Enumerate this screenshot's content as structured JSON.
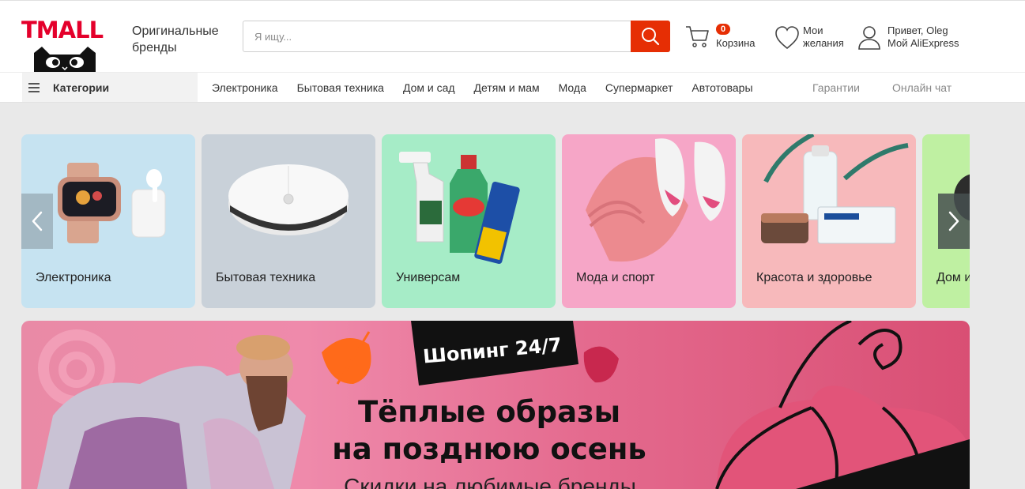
{
  "header": {
    "logo_text": "TMALL",
    "brand_tagline": "Оригинальные бренды",
    "search_placeholder": "Я ищу...",
    "cart_count": "0",
    "cart_label": "Корзина",
    "wishlist_label_1": "Мои",
    "wishlist_label_2": "желания",
    "account_greeting": "Привет, Oleg",
    "account_link": "Мой AliExpress"
  },
  "nav": {
    "categories_label": "Категории",
    "links": [
      "Электроника",
      "Бытовая техника",
      "Дом и сад",
      "Детям и мам",
      "Мода",
      "Супермаркет",
      "Автотовары"
    ],
    "right_links": [
      "Гарантии",
      "Онлайн чат"
    ]
  },
  "category_cards": [
    {
      "label": "Электроника",
      "bg": "#c6e3f1"
    },
    {
      "label": "Бытовая техника",
      "bg": "#c9d1d9"
    },
    {
      "label": "Универсам",
      "bg": "#a6ecc7"
    },
    {
      "label": "Мода и спорт",
      "bg": "#f6a6c7"
    },
    {
      "label": "Красота и здоровье",
      "bg": "#f7b9bb"
    },
    {
      "label": "Дом и",
      "bg": "#bff0a2"
    }
  ],
  "banner": {
    "tag": "Шопинг 24/7",
    "title_line1": "Тёплые образы",
    "title_line2": "на позднюю осень",
    "subtitle": "Скидки на любимые бренды"
  },
  "colors": {
    "accent": "#e62e04",
    "brand": "#e4002b"
  }
}
